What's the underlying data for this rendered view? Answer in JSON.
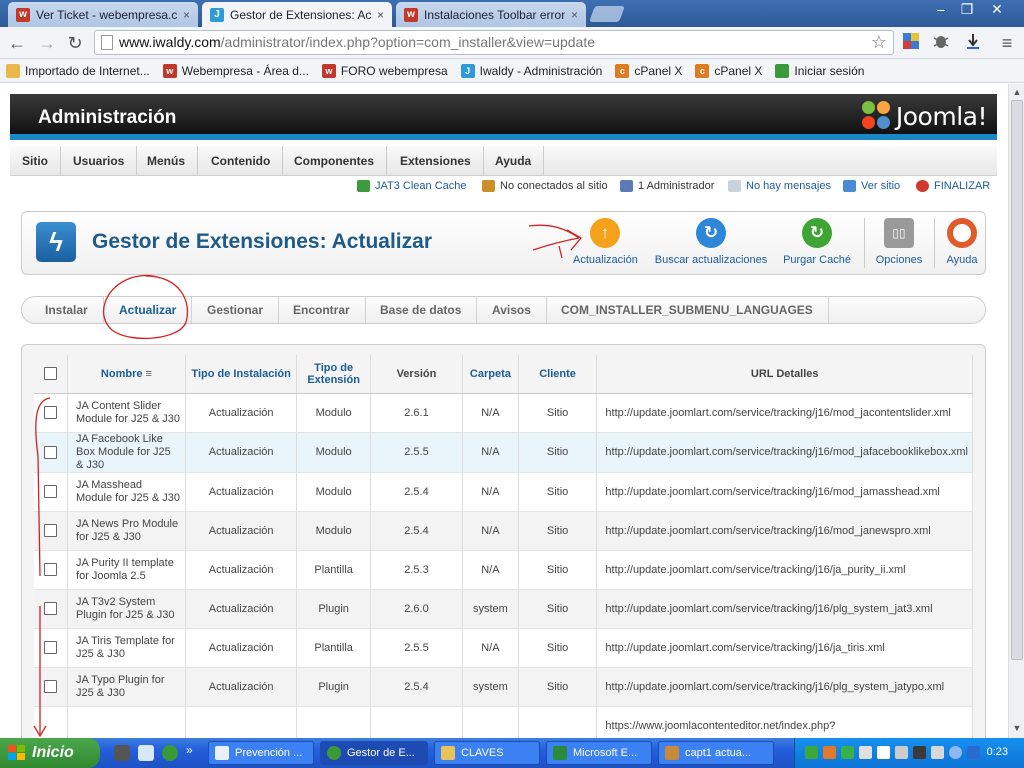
{
  "browser": {
    "tabs": [
      {
        "title": "Ver Ticket - webempresa.com",
        "favicon": "w-icon",
        "active": false
      },
      {
        "title": "Gestor de Extensiones: Actualizar",
        "favicon": "joomla-icon",
        "active": true
      },
      {
        "title": "Instalaciones Toolbar erroneas",
        "favicon": "w-icon",
        "active": false
      }
    ],
    "tab_close": "×",
    "window_controls": {
      "minimize": "–",
      "maximize": "❐",
      "close": "✕"
    },
    "url": {
      "host": "www.iwaldy.com",
      "path": "/administrator/index.php?option=com_installer&view=update"
    },
    "nav_icons": {
      "back": "←",
      "forward": "→",
      "reload": "↻",
      "star": "☆",
      "menu": "≡"
    },
    "bookmarks": [
      {
        "label": "Importado de Internet...",
        "icon": "folder-icon",
        "color": "#e8b84a"
      },
      {
        "label": "Webempresa - Área d...",
        "icon": "w-icon",
        "color": "#c0392b"
      },
      {
        "label": "FORO webempresa",
        "icon": "w-icon",
        "color": "#c0392b"
      },
      {
        "label": "Iwaldy - Administración",
        "icon": "joomla-icon",
        "color": "#2e9bd6"
      },
      {
        "label": "cPanel X",
        "icon": "cpanel-icon",
        "color": "#e07b1f"
      },
      {
        "label": "cPanel X",
        "icon": "cpanel-icon",
        "color": "#e07b1f"
      },
      {
        "label": "Iniciar sesión",
        "icon": "windows-icon",
        "color": "#3a9a3a"
      }
    ]
  },
  "admin": {
    "title": "Administración",
    "brand": "Joomla!",
    "menu": [
      "Sitio",
      "Usuarios",
      "Menús",
      "Contenido",
      "Componentes",
      "Extensiones",
      "Ayuda"
    ],
    "status": {
      "cache": "JAT3 Clean Cache",
      "offline": "No conectados al sitio",
      "admins": "1 Administrador",
      "messages": "No hay mensajes",
      "view_site": "Ver sitio",
      "logout": "FINALIZAR"
    },
    "page_title": "Gestor de Extensiones: Actualizar",
    "toolbar": [
      {
        "label": "Actualización",
        "icon": "update-arrow-icon",
        "color": "#f5a21a"
      },
      {
        "label": "Buscar actualizaciones",
        "icon": "refresh-icon",
        "color": "#2e86d6"
      },
      {
        "label": "Purgar Caché",
        "icon": "purge-icon",
        "color": "#3ea534"
      },
      {
        "label": "Opciones",
        "icon": "options-icon",
        "color": "#8a8a8a"
      },
      {
        "label": "Ayuda",
        "icon": "help-ring-icon",
        "color": "#e05a2a"
      }
    ],
    "subnav": [
      "Instalar",
      "Actualizar",
      "Gestionar",
      "Encontrar",
      "Base de datos",
      "Avisos",
      "COM_INSTALLER_SUBMENU_LANGUAGES"
    ],
    "subnav_active": "Actualizar",
    "table": {
      "headers": {
        "name": "Nombre",
        "install_type": "Tipo de Instalación",
        "ext_type": "Tipo de Extensión",
        "version": "Versión",
        "folder": "Carpeta",
        "client": "Cliente",
        "url": "URL Detalles"
      },
      "rows": [
        {
          "name": "JA Content Slider Module for J25 & J30",
          "install_type": "Actualización",
          "ext_type": "Modulo",
          "version": "2.6.1",
          "folder": "N/A",
          "client": "Sitio",
          "url": "http://update.joomlart.com/service/tracking/j16/mod_jacontentslider.xml"
        },
        {
          "name": "JA Facebook Like Box Module for J25 & J30",
          "install_type": "Actualización",
          "ext_type": "Modulo",
          "version": "2.5.5",
          "folder": "N/A",
          "client": "Sitio",
          "url": "http://update.joomlart.com/service/tracking/j16/mod_jafacebooklikebox.xml"
        },
        {
          "name": "JA Masshead Module for J25 & J30",
          "install_type": "Actualización",
          "ext_type": "Modulo",
          "version": "2.5.4",
          "folder": "N/A",
          "client": "Sitio",
          "url": "http://update.joomlart.com/service/tracking/j16/mod_jamasshead.xml"
        },
        {
          "name": "JA News Pro Module for J25 & J30",
          "install_type": "Actualización",
          "ext_type": "Modulo",
          "version": "2.5.4",
          "folder": "N/A",
          "client": "Sitio",
          "url": "http://update.joomlart.com/service/tracking/j16/mod_janewspro.xml"
        },
        {
          "name": "JA Purity II template for Joomla 2.5",
          "install_type": "Actualización",
          "ext_type": "Plantilla",
          "version": "2.5.3",
          "folder": "N/A",
          "client": "Sitio",
          "url": "http://update.joomlart.com/service/tracking/j16/ja_purity_ii.xml"
        },
        {
          "name": "JA T3v2 System Plugin for J25 & J30",
          "install_type": "Actualización",
          "ext_type": "Plugin",
          "version": "2.6.0",
          "folder": "system",
          "client": "Sitio",
          "url": "http://update.joomlart.com/service/tracking/j16/plg_system_jat3.xml"
        },
        {
          "name": "JA Tiris Template for J25 & J30",
          "install_type": "Actualización",
          "ext_type": "Plantilla",
          "version": "2.5.5",
          "folder": "N/A",
          "client": "Sitio",
          "url": "http://update.joomlart.com/service/tracking/j16/ja_tiris.xml"
        },
        {
          "name": "JA Typo Plugin for J25 & J30",
          "install_type": "Actualización",
          "ext_type": "Plugin",
          "version": "2.5.4",
          "folder": "system",
          "client": "Sitio",
          "url": "http://update.joomlart.com/service/tracking/j16/plg_system_jatypo.xml"
        },
        {
          "name": "",
          "install_type": "",
          "ext_type": "",
          "version": "",
          "folder": "",
          "client": "",
          "url": "https://www.joomlacontenteditor.net/index.php?"
        }
      ]
    }
  },
  "taskbar": {
    "start": "Inicio",
    "tasks": [
      {
        "label": "Prevención ...",
        "icon": "outlook-icon",
        "active": false
      },
      {
        "label": "Gestor de E...",
        "icon": "chrome-icon",
        "active": true
      },
      {
        "label": "CLAVES",
        "icon": "folder-icon",
        "active": false
      },
      {
        "label": "Microsoft E...",
        "icon": "excel-icon",
        "active": false
      },
      {
        "label": "capt1 actua...",
        "icon": "paint-icon",
        "active": false
      }
    ],
    "clock": "0:23",
    "more": "»"
  },
  "colors": {
    "accent": "#1a87c8",
    "link": "#1a5d9a",
    "annotation": "#d42020"
  }
}
